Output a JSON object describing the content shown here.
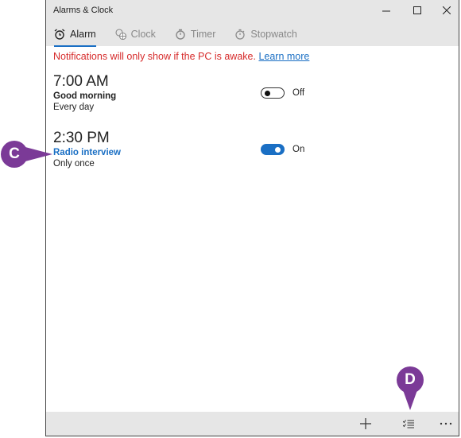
{
  "window": {
    "title": "Alarms & Clock",
    "controls": {
      "minimize": "minimize-icon",
      "maximize": "maximize-icon",
      "close": "close-icon"
    }
  },
  "tabs": [
    {
      "label": "Alarm",
      "icon": "alarm-clock-icon",
      "active": true
    },
    {
      "label": "Clock",
      "icon": "world-clock-icon",
      "active": false
    },
    {
      "label": "Timer",
      "icon": "timer-icon",
      "active": false
    },
    {
      "label": "Stopwatch",
      "icon": "stopwatch-icon",
      "active": false
    }
  ],
  "notice": {
    "text": "Notifications will only show if the PC is awake.",
    "link": "Learn more",
    "color": "#d62a2a"
  },
  "alarms": [
    {
      "time": "7:00 AM",
      "name": "Good morning",
      "repeat": "Every day",
      "enabled": false,
      "state_label": "Off"
    },
    {
      "time": "2:30 PM",
      "name": "Radio interview",
      "repeat": "Only once",
      "enabled": true,
      "state_label": "On"
    }
  ],
  "bottom_bar": {
    "add": "add-icon",
    "select": "select-multiple-icon",
    "more": "more-icon"
  },
  "callouts": [
    {
      "letter": "C",
      "color": "#7b3a97"
    },
    {
      "letter": "D",
      "color": "#7b3a97"
    }
  ],
  "accent_color": "#1a6fc4"
}
